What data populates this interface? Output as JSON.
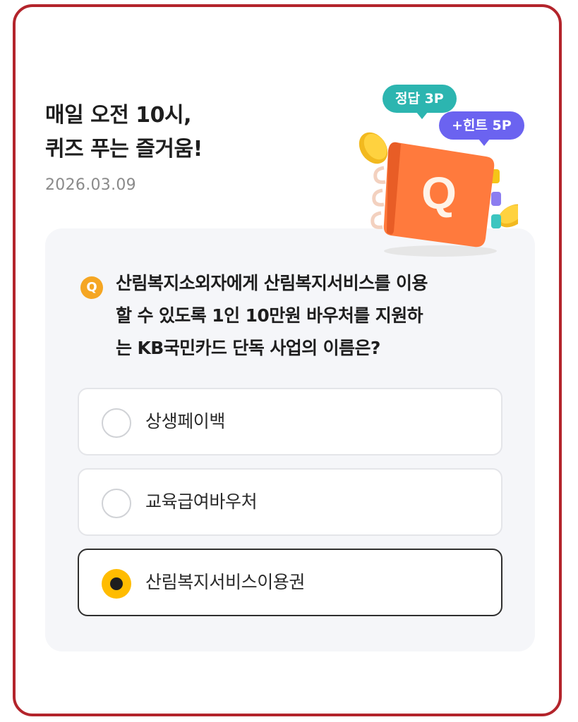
{
  "header": {
    "title_line1": "매일 오전 10시,",
    "title_line2": "퀴즈 푸는 즐거움!",
    "date": "2026.03.09"
  },
  "illustration": {
    "answer_badge": "정답 3P",
    "hint_badge": "+힌트 5P",
    "notebook_letter": "Q",
    "icon": "quiz-notebook-icon"
  },
  "quiz": {
    "q_marker": "Q",
    "question_line1": "산림복지소외자에게 산림복지서비스를 이용",
    "question_line2": "할 수 있도록 1인 10만원 바우처를 지원하",
    "question_line3": "는 KB국민카드 단독 사업의 이름은?",
    "options": [
      {
        "label": "상생페이백",
        "selected": false
      },
      {
        "label": "교육급여바우처",
        "selected": false
      },
      {
        "label": "산림복지서비스이용권",
        "selected": true
      }
    ]
  },
  "colors": {
    "frame_border": "#b3242b",
    "accent_yellow": "#ffbc00",
    "answer_badge": "#2cb5b0",
    "hint_badge": "#6b63f0",
    "q_marker": "#f5a623"
  }
}
